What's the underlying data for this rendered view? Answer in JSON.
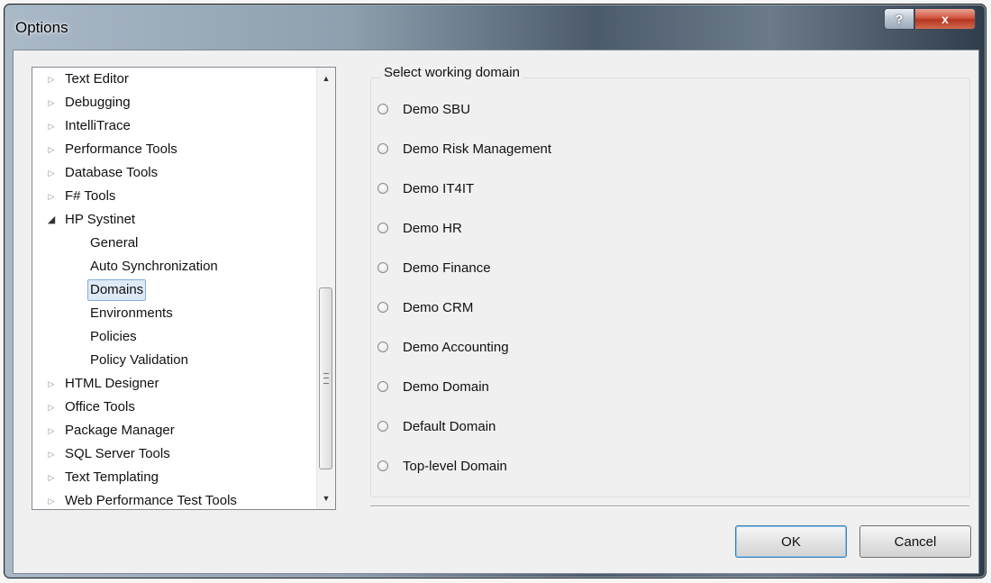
{
  "window": {
    "title": "Options"
  },
  "titlebar_buttons": {
    "help": "?",
    "close": "x"
  },
  "tree": {
    "items": [
      {
        "label": "Text Editor",
        "expanded": false
      },
      {
        "label": "Debugging",
        "expanded": false
      },
      {
        "label": "IntelliTrace",
        "expanded": false
      },
      {
        "label": "Performance Tools",
        "expanded": false
      },
      {
        "label": "Database Tools",
        "expanded": false
      },
      {
        "label": "F# Tools",
        "expanded": false
      },
      {
        "label": "HP Systinet",
        "expanded": true
      },
      {
        "label": "General",
        "child": true
      },
      {
        "label": "Auto Synchronization",
        "child": true
      },
      {
        "label": "Domains",
        "child": true,
        "selected": true
      },
      {
        "label": "Environments",
        "child": true
      },
      {
        "label": "Policies",
        "child": true
      },
      {
        "label": "Policy Validation",
        "child": true
      },
      {
        "label": "HTML Designer",
        "expanded": false
      },
      {
        "label": "Office Tools",
        "expanded": false
      },
      {
        "label": "Package Manager",
        "expanded": false
      },
      {
        "label": "SQL Server Tools",
        "expanded": false
      },
      {
        "label": "Text Templating",
        "expanded": false
      },
      {
        "label": "Web Performance Test Tools",
        "expanded": false
      }
    ]
  },
  "domains": {
    "group_label": "Select working domain",
    "options": [
      "Demo SBU",
      "Demo Risk Management",
      "Demo IT4IT",
      "Demo HR",
      "Demo Finance",
      "Demo CRM",
      "Demo Accounting",
      "Demo Domain",
      "Default Domain",
      "Top-level Domain"
    ]
  },
  "buttons": {
    "ok": "OK",
    "cancel": "Cancel"
  },
  "colors": {
    "selection_bg": "#dfeaf8",
    "selection_border": "#84acdd",
    "close_red": "#c8452e"
  }
}
